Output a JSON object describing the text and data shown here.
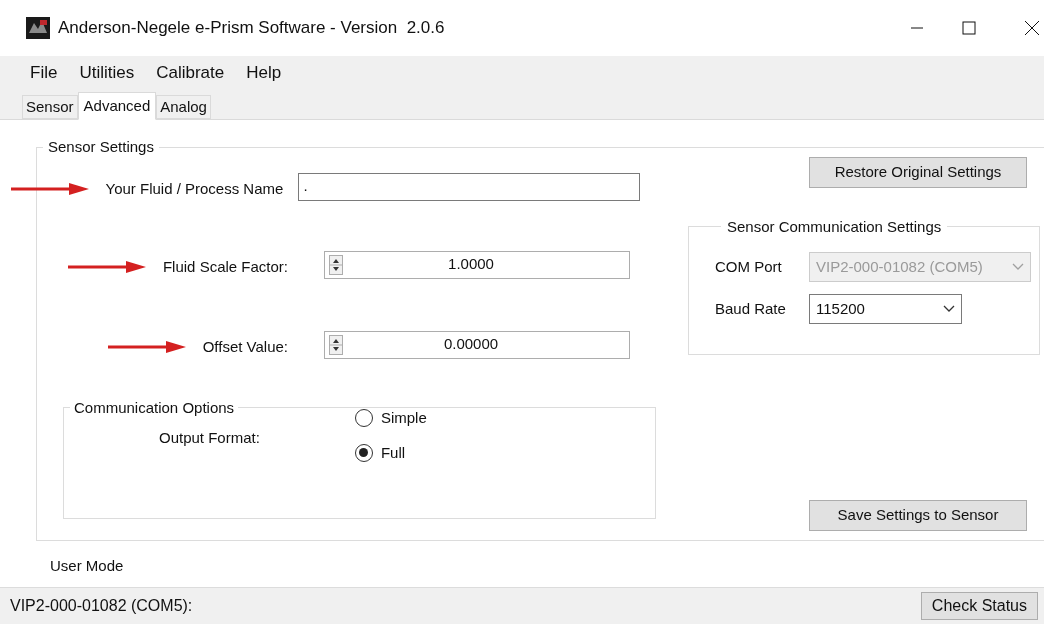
{
  "window": {
    "title": "Anderson-Negele e-Prism Software - Version  2.0.6"
  },
  "menu": [
    "File",
    "Utilities",
    "Calibrate",
    "Help"
  ],
  "tabs": [
    {
      "label": "Sensor",
      "selected": false
    },
    {
      "label": "Advanced",
      "selected": true
    },
    {
      "label": "Analog",
      "selected": false
    }
  ],
  "sensor_settings": {
    "title": "Sensor Settings",
    "fields": [
      {
        "kind": "text",
        "label": "Your Fluid / Process Name",
        "value": ".",
        "annotated": true
      },
      {
        "kind": "spin",
        "label": "Fluid Scale Factor:",
        "value": "1.0000",
        "annotated": true
      },
      {
        "kind": "spin",
        "label": "Offset Value:",
        "value": "0.00000",
        "annotated": true
      }
    ],
    "restore_button": "Restore Original Settings",
    "communication_options": {
      "title": "Communication Options",
      "label": "Output Format:",
      "options": [
        {
          "label": "Simple",
          "selected": false
        },
        {
          "label": "Full",
          "selected": true
        }
      ]
    },
    "sensor_communication": {
      "title": "Sensor Communication Settings",
      "fields": [
        {
          "label": "COM Port",
          "value": "VIP2-000-01082 (COM5)",
          "disabled": true
        },
        {
          "label": "Baud Rate",
          "value": "115200",
          "disabled": false
        }
      ]
    },
    "save_button": "Save Settings to Sensor"
  },
  "mode": "User Mode",
  "status_bar": {
    "text": "VIP2-000-01082 (COM5):",
    "button": "Check Status"
  }
}
